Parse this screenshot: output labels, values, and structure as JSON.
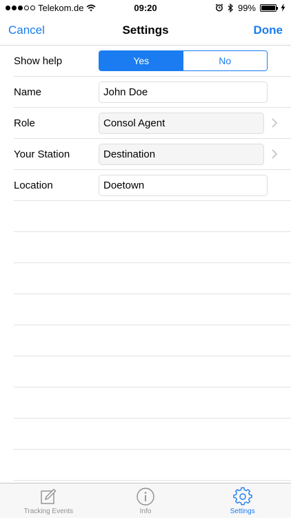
{
  "status_bar": {
    "carrier": "Telekom.de",
    "time": "09:20",
    "battery": "99%",
    "battery_level": 0.99
  },
  "nav": {
    "cancel_label": "Cancel",
    "title": "Settings",
    "done_label": "Done"
  },
  "form": {
    "show_help": {
      "label": "Show help",
      "options": [
        "Yes",
        "No"
      ],
      "selected": "Yes"
    },
    "name": {
      "label": "Name",
      "value": "John Doe"
    },
    "role": {
      "label": "Role",
      "value": "Consol Agent"
    },
    "station": {
      "label": "Your Station",
      "value": "Destination"
    },
    "location": {
      "label": "Location",
      "value": "Doetown"
    }
  },
  "tabs": [
    {
      "label": "Tracking Events",
      "icon": "edit-icon",
      "active": false
    },
    {
      "label": "Info",
      "icon": "info-icon",
      "active": false
    },
    {
      "label": "Settings",
      "icon": "gear-icon",
      "active": true
    }
  ],
  "colors": {
    "accent": "#1a7cf0"
  }
}
